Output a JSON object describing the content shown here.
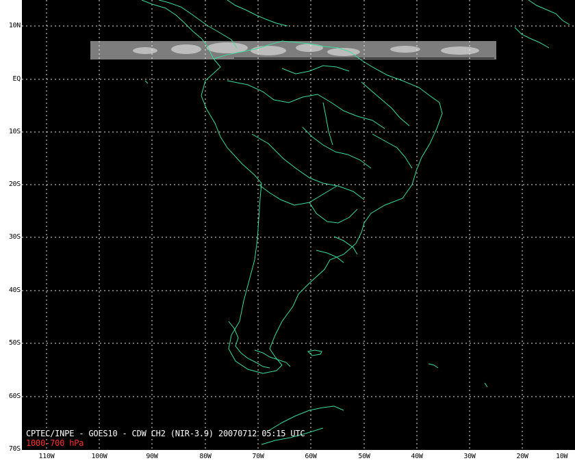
{
  "caption": {
    "main": "CPTEC/INPE - GOES10 - CDW CH2 (NIR-3.9) 20070712 05:15 UTC",
    "level": "1000-700 hPa"
  },
  "axes": {
    "lat_labels": [
      "10N",
      "EQ",
      "10S",
      "20S",
      "30S",
      "40S",
      "50S",
      "60S",
      "70S"
    ],
    "lon_labels": [
      "110W",
      "100W",
      "90W",
      "80W",
      "70W",
      "60W",
      "50W",
      "40W",
      "30W",
      "20W",
      "10W"
    ]
  },
  "colors": {
    "background": "#000000",
    "coastline": "#3ddc9c",
    "grid": "#ffffff",
    "caption": "#ffffff",
    "level": "#ff3030",
    "imagery_strip": "#8a8a8a"
  }
}
